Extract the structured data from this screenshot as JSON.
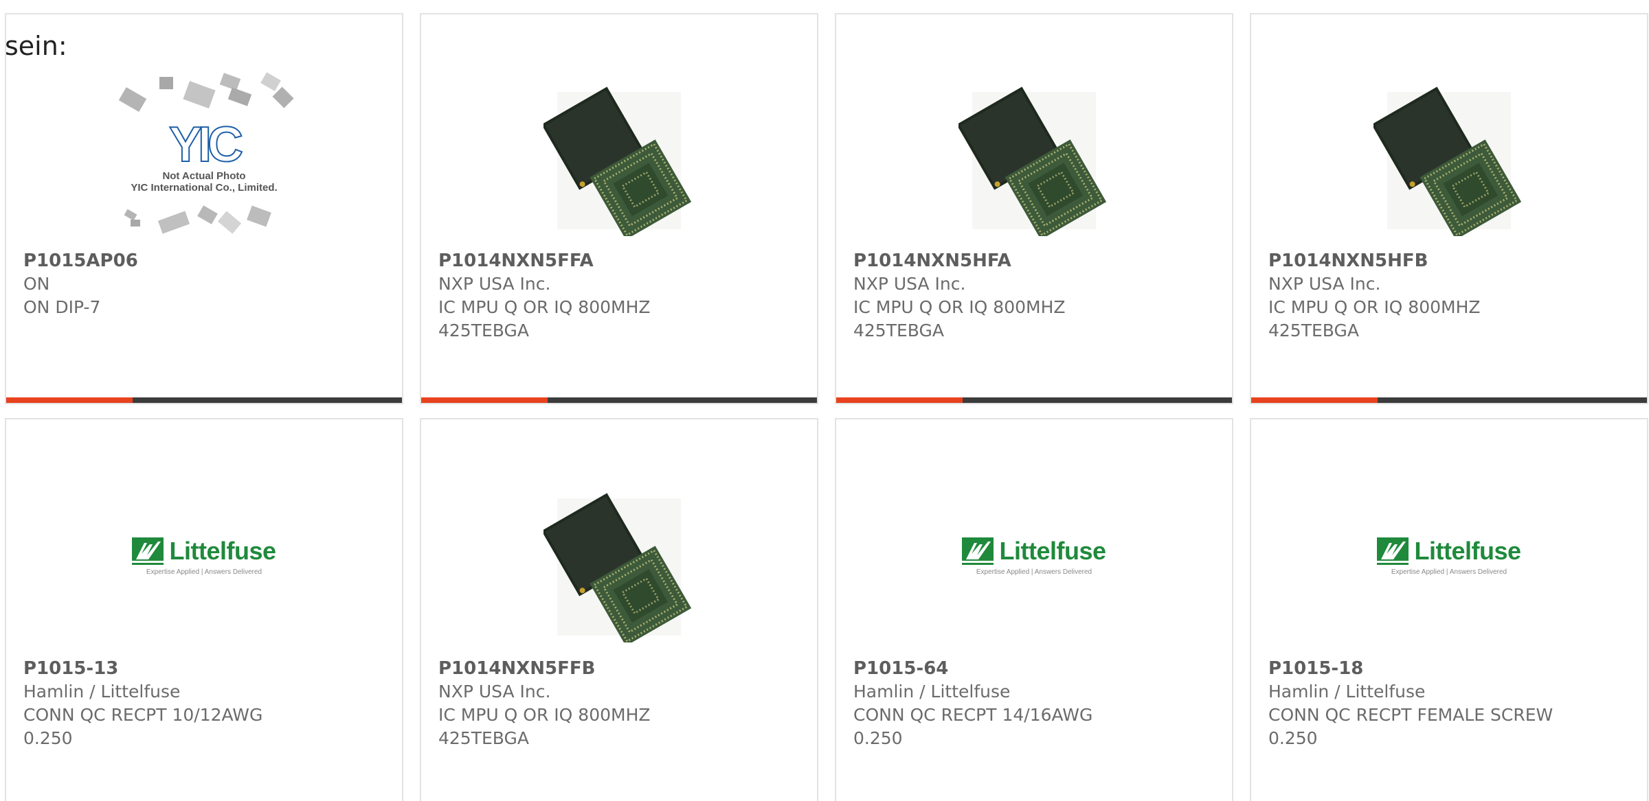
{
  "intro_text": "sein:",
  "cards": [
    {
      "part": "P1015AP06",
      "lines": [
        "ON",
        "ON DIP-7"
      ],
      "image": "yic-placeholder",
      "placeholder_text": [
        "Not Actual Photo",
        "YIC International Co., Limited."
      ],
      "logo_text": "YIC"
    },
    {
      "part": "P1014NXN5FFA",
      "lines": [
        "NXP USA Inc.",
        "IC MPU Q OR IQ 800MHZ",
        "425TEBGA"
      ],
      "image": "bga-chip"
    },
    {
      "part": "P1014NXN5HFA",
      "lines": [
        "NXP USA Inc.",
        "IC MPU Q OR IQ 800MHZ",
        "425TEBGA"
      ],
      "image": "bga-chip"
    },
    {
      "part": "P1014NXN5HFB",
      "lines": [
        "NXP USA Inc.",
        "IC MPU Q OR IQ 800MHZ",
        "425TEBGA"
      ],
      "image": "bga-chip"
    },
    {
      "part": "P1015-13",
      "lines": [
        "Hamlin / Littelfuse",
        "CONN QC RECPT 10/12AWG",
        "0.250"
      ],
      "image": "littelfuse-logo",
      "logo_text": "Littelfuse",
      "logo_tagline": "Expertise Applied | Answers Delivered"
    },
    {
      "part": "P1014NXN5FFB",
      "lines": [
        "NXP USA Inc.",
        "IC MPU Q OR IQ 800MHZ",
        "425TEBGA"
      ],
      "image": "bga-chip"
    },
    {
      "part": "P1015-64",
      "lines": [
        "Hamlin / Littelfuse",
        "CONN QC RECPT 14/16AWG",
        "0.250"
      ],
      "image": "littelfuse-logo",
      "logo_text": "Littelfuse",
      "logo_tagline": "Expertise Applied | Answers Delivered"
    },
    {
      "part": "P1015-18",
      "lines": [
        "Hamlin / Littelfuse",
        "CONN QC RECPT FEMALE SCREW",
        "0.250"
      ],
      "image": "littelfuse-logo",
      "logo_text": "Littelfuse",
      "logo_tagline": "Expertise Applied | Answers Delivered"
    }
  ],
  "colors": {
    "accent": "#e8421e",
    "bar": "#3c3c3c",
    "littelfuse_green": "#1f8a3c",
    "text": "#6b6b6b"
  }
}
